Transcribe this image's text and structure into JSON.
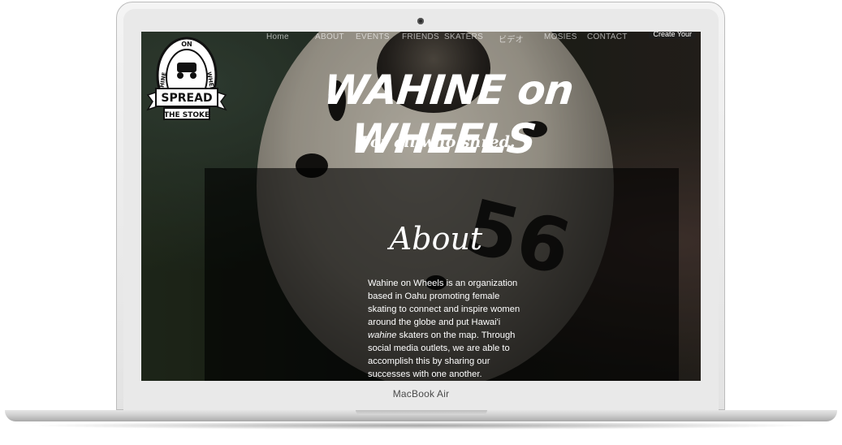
{
  "device": {
    "brand_label": "MacBook Air"
  },
  "nav": {
    "items": [
      "Home",
      "ABOUT",
      "EVENTS",
      "FRIENDS",
      "SKATERS",
      "ビデオ",
      "MOSIES",
      "CONTACT"
    ],
    "cta_label": "Create Your"
  },
  "logo": {
    "text_top_left": "WAHINE",
    "text_top_mid": "ON",
    "text_top_right": "WHEELS",
    "banner_line1": "SPREAD",
    "banner_line2": "THE STOKE"
  },
  "hero": {
    "title": "WAHINE on WHEELS",
    "subtitle": "For all who shred."
  },
  "about": {
    "heading": "About",
    "body_before_em": "Wahine on Wheels is an organization based in Oahu promoting female skating to connect and inspire women around the globe and put Hawai'i ",
    "body_em": "wahine",
    "body_after_em": " skaters on the map. Through social media outlets, we are able to accomplish this by sharing our successes with one another."
  },
  "background": {
    "wheel_number": "56"
  },
  "colors": {
    "panel": "#000000",
    "text": "#ffffff",
    "nav_text": "#c8c8c8",
    "frame": "#e6e6e6"
  }
}
